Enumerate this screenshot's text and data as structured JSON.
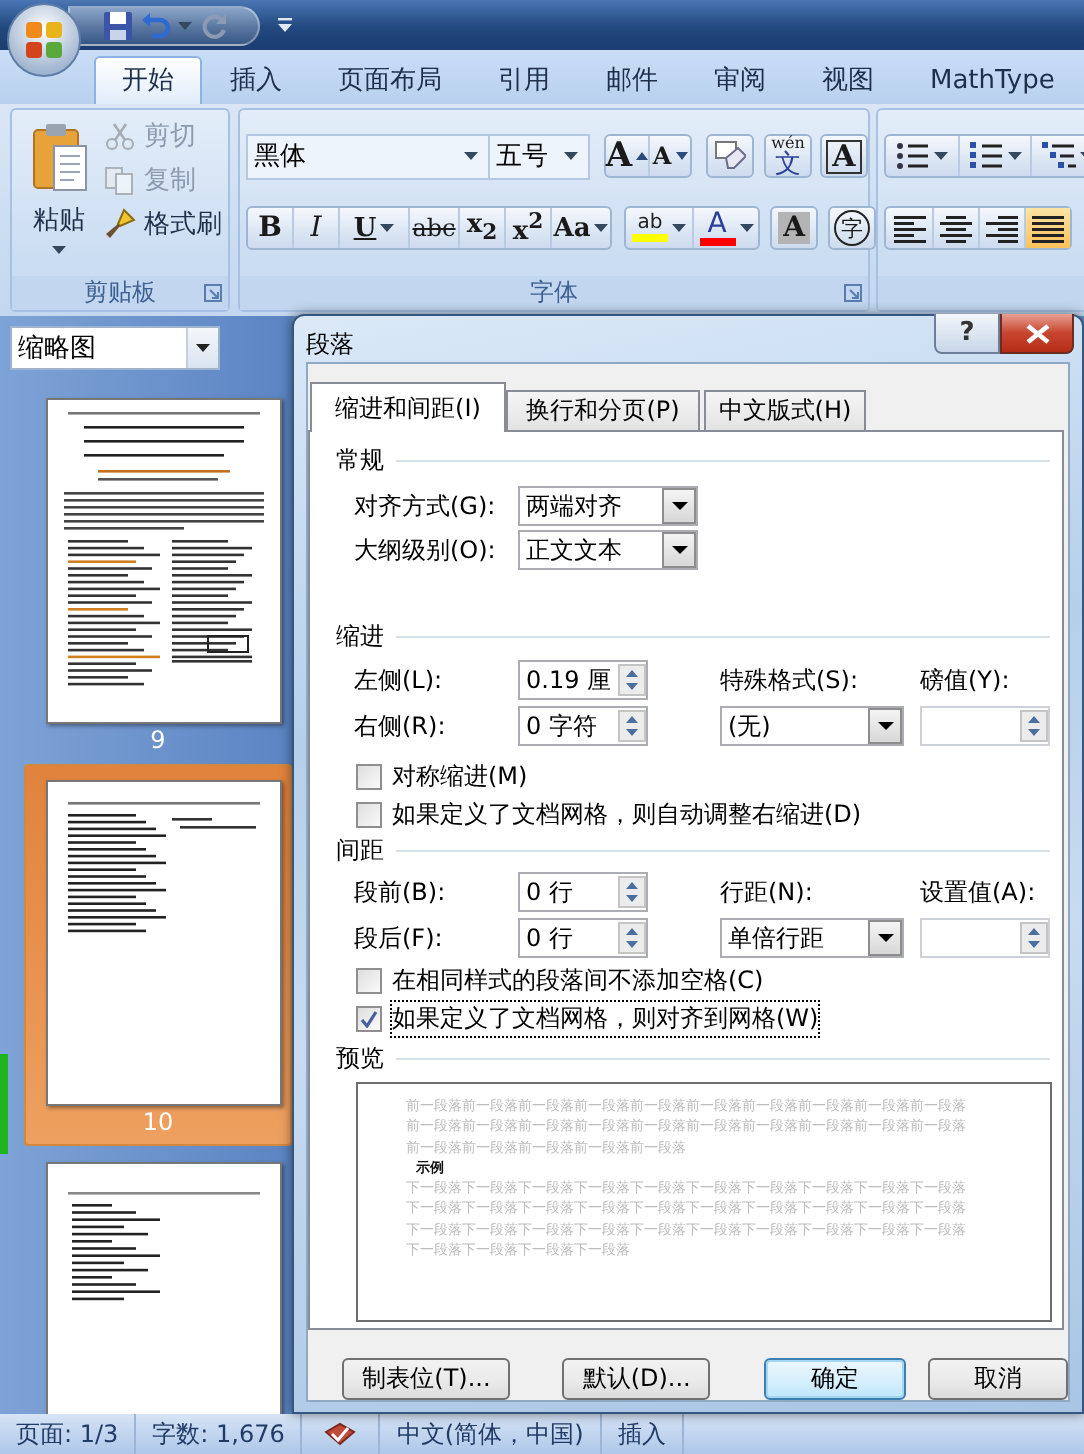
{
  "ribbon_tabs": [
    {
      "label": "开始",
      "selected": true
    },
    {
      "label": "插入",
      "selected": false
    },
    {
      "label": "页面布局",
      "selected": false
    },
    {
      "label": "引用",
      "selected": false
    },
    {
      "label": "邮件",
      "selected": false
    },
    {
      "label": "审阅",
      "selected": false
    },
    {
      "label": "视图",
      "selected": false
    },
    {
      "label": "MathType",
      "selected": false
    }
  ],
  "clipboard": {
    "paste": "粘贴",
    "label": "剪贴板",
    "tools": [
      {
        "kind": "cut",
        "label": "剪切",
        "disabled": true
      },
      {
        "kind": "copy",
        "label": "复制",
        "disabled": true
      },
      {
        "kind": "painter",
        "label": "格式刷",
        "disabled": false
      }
    ]
  },
  "font": {
    "name": "黑体",
    "size": "五号",
    "label": "字体",
    "row1": [
      {
        "kind": "grow",
        "glyph": "A"
      },
      {
        "kind": "shrink",
        "glyph": "A"
      },
      {
        "kind": "clear"
      },
      {
        "kind": "phonetic",
        "glyph": "wén",
        "base": "文"
      },
      {
        "kind": "border",
        "glyph": "A"
      }
    ],
    "row2": [
      {
        "kind": "bold",
        "glyph": "B"
      },
      {
        "kind": "italic",
        "glyph": "I"
      },
      {
        "kind": "underline",
        "glyph": "U"
      },
      {
        "kind": "strike",
        "glyph": "abc"
      },
      {
        "kind": "sub",
        "glyph": "x$_{2}$"
      },
      {
        "kind": "sup",
        "glyph": "x$^{2}$"
      },
      {
        "kind": "case",
        "glyph": "Aa"
      },
      {
        "kind": "highlight",
        "glyph": "ab",
        "color": "#ffff00"
      },
      {
        "kind": "fontcolor",
        "glyph": "A",
        "color": "#ff0000"
      },
      {
        "kind": "shading",
        "glyph": "A"
      },
      {
        "kind": "enclose",
        "glyph": "字"
      }
    ]
  },
  "paragraph": {
    "list_buttons": [
      {
        "kind": "bullets"
      },
      {
        "kind": "numbering"
      },
      {
        "kind": "multilevel"
      }
    ],
    "align_buttons": [
      {
        "kind": "left",
        "selected": false
      },
      {
        "kind": "center",
        "selected": false
      },
      {
        "kind": "right",
        "selected": false
      },
      {
        "kind": "justify",
        "selected": true
      }
    ]
  },
  "navigation": {
    "view": "缩略图",
    "pages": [
      {
        "number": "9",
        "selected": false
      },
      {
        "number": "10",
        "selected": true
      },
      {
        "selected": false
      }
    ]
  },
  "dialog": {
    "title": "段落",
    "help": "?",
    "tabs": [
      {
        "label": "缩进和间距(I)",
        "selected": true
      },
      {
        "label": "换行和分页(P)",
        "selected": false
      },
      {
        "label": "中文版式(H)",
        "selected": false
      }
    ],
    "general": {
      "heading": "常规",
      "alignment": {
        "label": "对齐方式(G):",
        "value": "两端对齐"
      },
      "outline_level": {
        "label": "大纲级别(O):",
        "value": "正文文本"
      }
    },
    "indentation": {
      "heading": "缩进",
      "left": {
        "label": "左侧(L):",
        "value": "0.19 厘"
      },
      "right": {
        "label": "右侧(R):",
        "value": "0 字符"
      },
      "special": {
        "label": "特殊格式(S):",
        "value": "(无)"
      },
      "by": {
        "label": "磅值(Y):"
      },
      "checkboxes": [
        {
          "label": "对称缩进(M)",
          "checked": false,
          "focused": false
        },
        {
          "label": "如果定义了文档网格，则自动调整右缩进(D)",
          "checked": false,
          "focused": false
        }
      ]
    },
    "spacing": {
      "heading": "间距",
      "before": {
        "label": "段前(B):",
        "value": "0 行"
      },
      "after": {
        "label": "段后(F):",
        "value": "0 行"
      },
      "line_spacing": {
        "label": "行距(N):",
        "value": "单倍行距"
      },
      "at": {
        "label": "设置值(A):"
      },
      "checkboxes": [
        {
          "label": "在相同样式的段落间不添加空格(C)",
          "checked": false,
          "focused": false
        },
        {
          "label": "如果定义了文档网格，则对齐到网格(W)",
          "checked": true,
          "focused": true
        }
      ]
    },
    "preview": {
      "heading": "预览",
      "lines": [
        {
          "kind": "previous",
          "text": "前一段落前一段落前一段落前一段落前一段落前一段落前一段落前一段落前一段落前一段落"
        },
        {
          "kind": "previous",
          "text": "前一段落前一段落前一段落前一段落前一段落前一段落前一段落前一段落前一段落前一段落"
        },
        {
          "kind": "previous",
          "text": "前一段落前一段落前一段落前一段落前一段落"
        },
        {
          "kind": "sample",
          "text": "示例"
        },
        {
          "kind": "next",
          "text": "下一段落下一段落下一段落下一段落下一段落下一段落下一段落下一段落下一段落下一段落"
        },
        {
          "kind": "next",
          "text": "下一段落下一段落下一段落下一段落下一段落下一段落下一段落下一段落下一段落下一段落"
        },
        {
          "kind": "next",
          "text": "下一段落下一段落下一段落下一段落下一段落下一段落下一段落下一段落下一段落下一段落"
        },
        {
          "kind": "next",
          "text": "下一段落下一段落下一段落下一段落"
        }
      ]
    },
    "buttons": [
      {
        "label": "制表位(T)...",
        "default": false
      },
      {
        "label": "默认(D)...",
        "default": false
      },
      {
        "label": "确定",
        "default": true
      },
      {
        "label": "取消",
        "default": false
      }
    ]
  },
  "status_bar": [
    {
      "kind": "text",
      "text": "页面: 1/3"
    },
    {
      "kind": "text",
      "text": "字数: 1,676"
    },
    {
      "kind": "proofing"
    },
    {
      "kind": "text",
      "text": "中文(简体，中国)"
    },
    {
      "kind": "text",
      "text": "插入"
    }
  ]
}
